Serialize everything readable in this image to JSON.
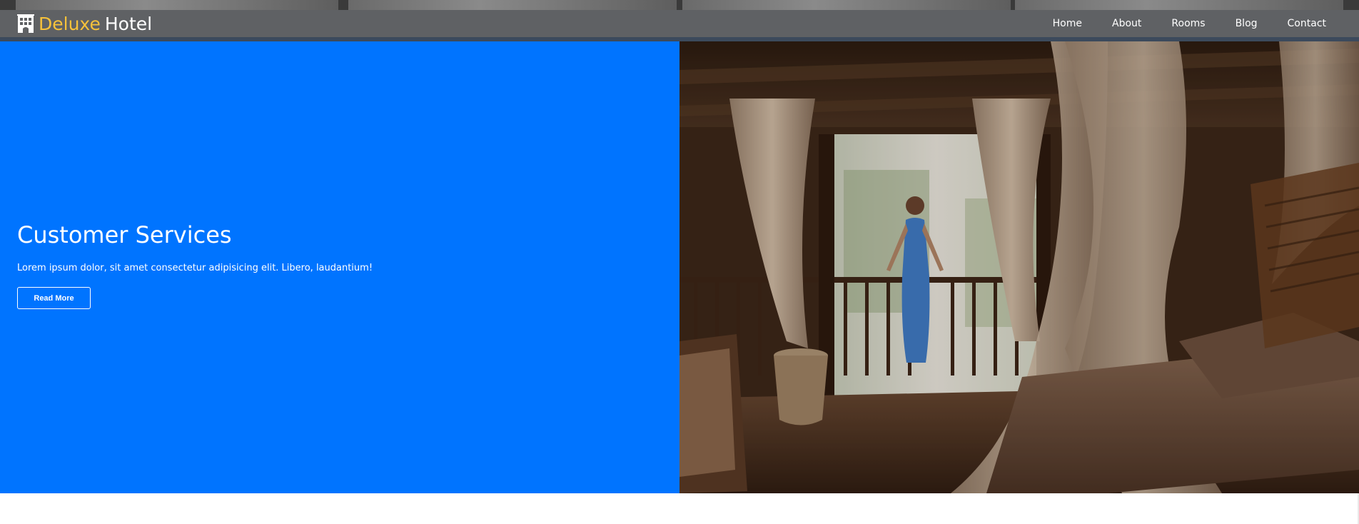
{
  "brand": {
    "icon": "hotel-building-icon",
    "name_accent": "Deluxe",
    "name_rest": "Hotel"
  },
  "nav": {
    "items": [
      {
        "label": "Home"
      },
      {
        "label": "About"
      },
      {
        "label": "Rooms"
      },
      {
        "label": "Blog"
      },
      {
        "label": "Contact"
      }
    ]
  },
  "hero": {
    "title": "Customer Services",
    "text": "Lorem ipsum dolor, sit amet consectetur adipisicing elit. Libero, laudantium!",
    "button_label": "Read More",
    "image": "hotel-room-canopy-bed-woman-balcony-photo"
  },
  "colors": {
    "accent": "#f7c23a",
    "hero_blue": "#0074ff",
    "navbar": "#5f6164"
  }
}
